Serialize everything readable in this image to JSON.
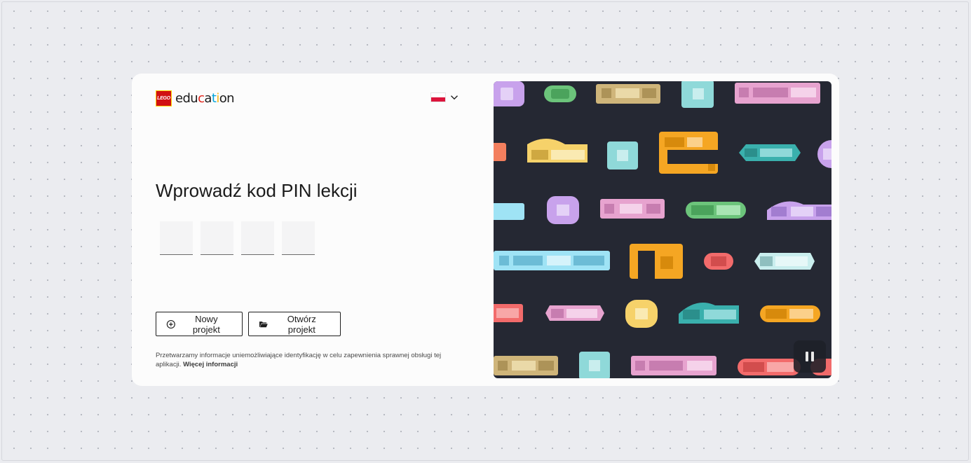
{
  "logo": {
    "lego": "LEGO",
    "edu_a": "edu",
    "edu_b": "c",
    "edu_c": "a",
    "edu_d": "t",
    "edu_e": "i",
    "edu_f": "o",
    "edu_g": "n"
  },
  "language": {
    "flag": "poland-flag-icon",
    "chevron": "chevron-down-icon"
  },
  "title": "Wprowadź kod PIN lekcji",
  "pin": {
    "fields": [
      "",
      "",
      "",
      ""
    ]
  },
  "buttons": {
    "new_project": "Nowy projekt",
    "open_project": "Otwórz projekt"
  },
  "privacy": {
    "text": "Przetwarzamy informacje uniemożliwiające identyfikację w celu zapewnienia sprawnej obsługi tej aplikacji.",
    "link": "Więcej informacji"
  },
  "media": {
    "pause_icon": "pause-icon"
  },
  "colors": {
    "background": "#ebecf0",
    "card": "#fcfcfc",
    "media_bg": "#252833",
    "lego_red": "#d01012"
  }
}
